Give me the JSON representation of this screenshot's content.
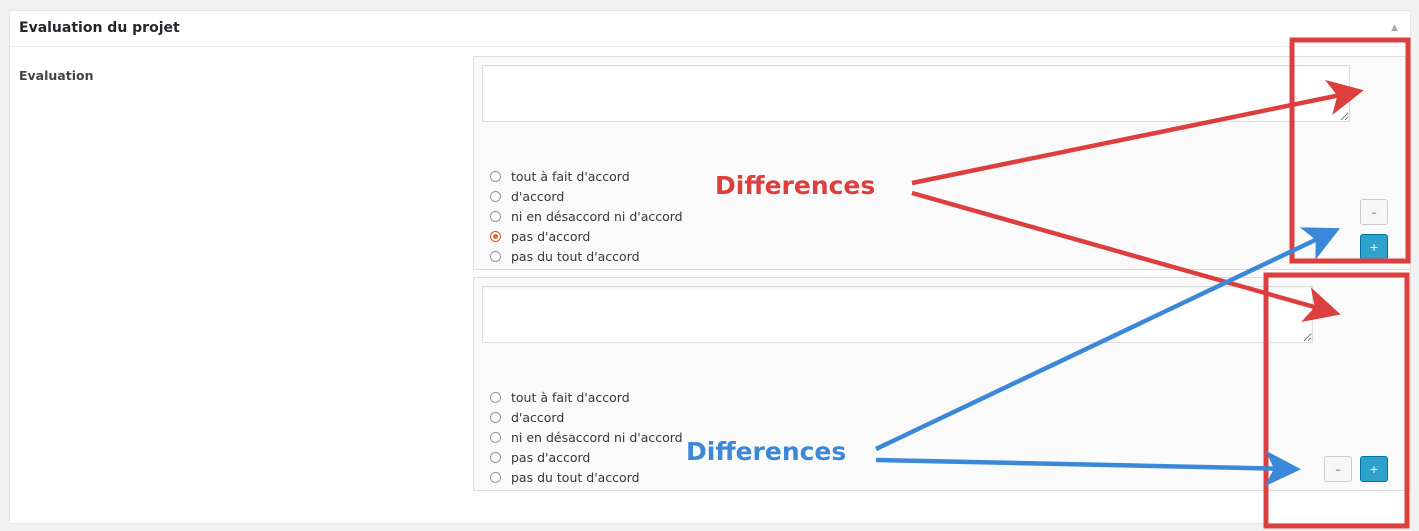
{
  "panel": {
    "title": "Evaluation du projet",
    "toggle_icon": "triangle-up"
  },
  "field_label": "Evaluation",
  "rows": [
    {
      "text": "",
      "options": [
        "tout à fait d'accord",
        "d'accord",
        "ni en désaccord ni d'accord",
        "pas d'accord",
        "pas du tout d'accord"
      ],
      "selected": 3,
      "remove": "–",
      "add": "+"
    },
    {
      "text": "",
      "options": [
        "tout à fait d'accord",
        "d'accord",
        "ni en désaccord ni d'accord",
        "pas d'accord",
        "pas du tout d'accord"
      ],
      "selected": null,
      "remove": "–",
      "add": "+"
    }
  ],
  "annotations": {
    "red_label": "Differences",
    "blue_label": "Differences",
    "red": "#dd3f3f",
    "blue": "#3b87d8"
  }
}
